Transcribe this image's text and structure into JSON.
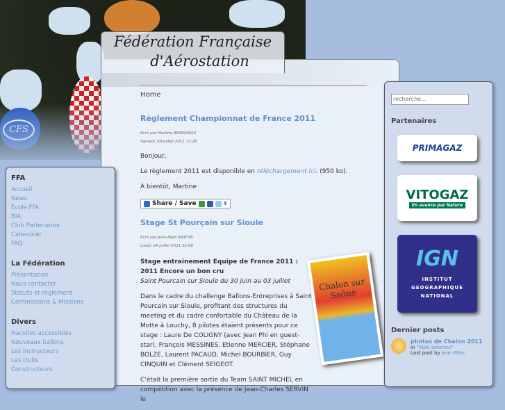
{
  "header": {
    "title_line1": "Fédération Française",
    "title_line2": "d'Aérostation",
    "logo_text": "CFS"
  },
  "breadcrumb": "Home",
  "posts": [
    {
      "title": "Règlement Championnat de France 2011",
      "author": "Ecrit par Martine BESNAINOU",
      "date": "Samedi, 09 Juillet 2011 13:28",
      "greeting": "Bonjour,",
      "body_pre": "Le règlement 2011 est disponible en ",
      "link": "téléchargement ici",
      "body_post": ". (950 ko).",
      "signoff": "À bientôt, Martine",
      "share_label": "Share / Save"
    },
    {
      "title": "Stage St Pourçain sur Sioule",
      "author": "Ecrit par Jean-Alain MARTIN",
      "date": "Lundi, 04 Juillet 2011 22:06",
      "subtitle": "Stage entrainement Equipe de France 2011 : 2011 Encore un bon cru",
      "subtitle_italic": "Saint Pourcain sur Sioule du 30 juin au 03 juillet",
      "para1": "Dans le cadre du challenge Ballons-Entreprises à Saint Pourcain sur Sioule, profitant des structures du meeting et du cadre confortable du Château de la Motte à Louchy, 8 pilotes étaient présents pour ce stage : Laure De COLIGNY (avec Jean Phi en guest-star), François MESSINES, Etienne MERCIER, Stéphane BOLZE, Laurent PACAUD, Michel BOURBIER, Guy CINQUIN et Clément SEIGEOT.",
      "para2": "C'était la première sortie du Team SAINT MICHEL en compétition avec la présence de Jean-Charles SERVIN le",
      "poster_text": "Chalon sur Saône"
    }
  ],
  "left_sidebar": [
    {
      "title": "FFA",
      "items": [
        "Accueil",
        "News",
        "Ecole FFA",
        "BIA",
        "Club Partenaires",
        "Calendrier",
        "FAQ"
      ]
    },
    {
      "title": "La Fédération",
      "items": [
        "Présentation",
        "Nous contacter",
        "Statuts et réglement",
        "Commissions & Missions"
      ]
    },
    {
      "title": "Divers",
      "items": [
        "Nacelles accessibles",
        "Nouveaux ballons",
        "Les instructeurs",
        "Les clubs",
        "Constructeurs"
      ]
    }
  ],
  "right_sidebar": {
    "search_placeholder": "recherche...",
    "partners_title": "Partenaires",
    "partners": [
      "PRIMAGAZ",
      "VITOGAZ",
      "En avance par Nature",
      "IGN",
      "INSTITUT GEOGRAPHIQUE NATIONAL"
    ],
    "last_posts_title": "Dernier posts",
    "last_post": {
      "title": "photos de Chalon 2011",
      "in_label": "In",
      "forum": "\"libre antenne\"",
      "by_label": "Last post by",
      "author": "Jean-Marc"
    }
  }
}
